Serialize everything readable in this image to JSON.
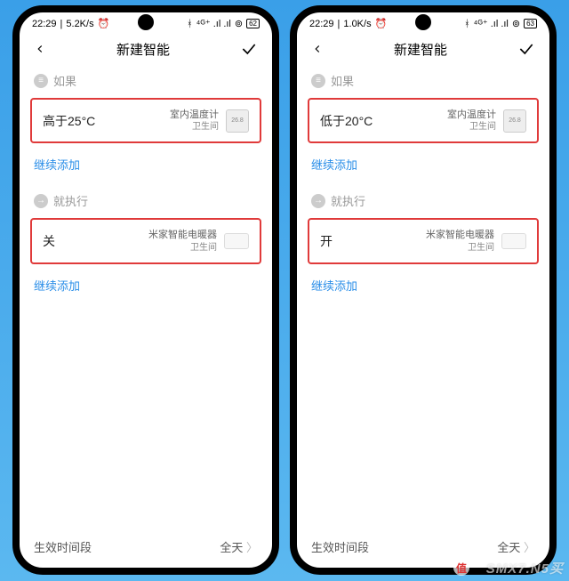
{
  "phones": [
    {
      "statusbar": {
        "time": "22:29",
        "net": "5.2K/s",
        "alarm": "⏰",
        "signal": "⁴ᴳ⁺ .ıl .ıl",
        "wifi": "⚞",
        "battery": "62"
      },
      "nav": {
        "title": "新建智能"
      },
      "if": {
        "header": "如果",
        "condition": "高于25°C",
        "device": "室内温度计",
        "room": "卫生间",
        "add": "继续添加"
      },
      "then": {
        "header": "就执行",
        "action": "关",
        "device": "米家智能电暖器",
        "room": "卫生间",
        "add": "继续添加"
      },
      "footer": {
        "label": "生效时间段",
        "value": "全天"
      }
    },
    {
      "statusbar": {
        "time": "22:29",
        "net": "1.0K/s",
        "alarm": "⏰",
        "signal": "⁴ᴳ⁺ .ıl .ıl",
        "wifi": "⚞",
        "battery": "63"
      },
      "nav": {
        "title": "新建智能"
      },
      "if": {
        "header": "如果",
        "condition": "低于20°C",
        "device": "室内温度计",
        "room": "卫生间",
        "add": "继续添加"
      },
      "then": {
        "header": "就执行",
        "action": "开",
        "device": "米家智能电暖器",
        "room": "卫生间",
        "add": "继续添加"
      },
      "footer": {
        "label": "生效时间段",
        "value": "全天"
      }
    }
  ],
  "watermark": {
    "text": "SMX7.N5买",
    "badge": "值"
  }
}
